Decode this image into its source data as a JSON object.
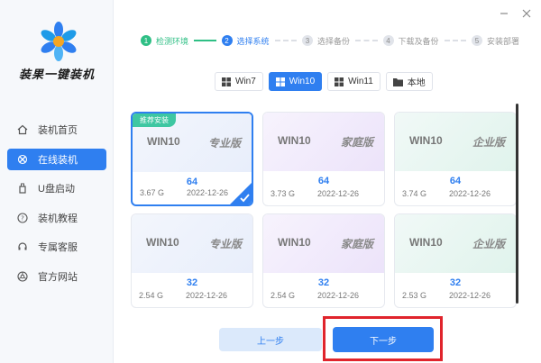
{
  "app": {
    "title": "装果一键装机"
  },
  "sidebar": {
    "items": [
      {
        "label": "装机首页",
        "icon": "home-icon"
      },
      {
        "label": "在线装机",
        "icon": "online-install-icon",
        "active": true
      },
      {
        "label": "U盘启动",
        "icon": "usb-icon"
      },
      {
        "label": "装机教程",
        "icon": "help-icon"
      },
      {
        "label": "专属客服",
        "icon": "headset-icon"
      },
      {
        "label": "官方网站",
        "icon": "browser-icon"
      }
    ]
  },
  "steps": [
    {
      "num": "1",
      "label": "检测环境",
      "state": "done"
    },
    {
      "num": "2",
      "label": "选择系统",
      "state": "current"
    },
    {
      "num": "3",
      "label": "选择备份",
      "state": "todo"
    },
    {
      "num": "4",
      "label": "下载及备份",
      "state": "todo"
    },
    {
      "num": "5",
      "label": "安装部署",
      "state": "todo"
    }
  ],
  "tabs": [
    {
      "label": "Win7",
      "icon": "windows-icon"
    },
    {
      "label": "Win10",
      "icon": "windows-icon",
      "active": true
    },
    {
      "label": "Win11",
      "icon": "windows-icon"
    },
    {
      "label": "本地",
      "icon": "folder-icon"
    }
  ],
  "cards": [
    {
      "name": "WIN10",
      "edition": "专业版",
      "bits": "64",
      "size": "3.67 G",
      "date": "2022-12-26",
      "color": "blue",
      "badge": "推荐安装",
      "selected": true
    },
    {
      "name": "WIN10",
      "edition": "家庭版",
      "bits": "64",
      "size": "3.73 G",
      "date": "2022-12-26",
      "color": "purple"
    },
    {
      "name": "WIN10",
      "edition": "企业版",
      "bits": "64",
      "size": "3.74 G",
      "date": "2022-12-26",
      "color": "green"
    },
    {
      "name": "WIN10",
      "edition": "专业版",
      "bits": "32",
      "size": "2.54 G",
      "date": "2022-12-26",
      "color": "blue"
    },
    {
      "name": "WIN10",
      "edition": "家庭版",
      "bits": "32",
      "size": "2.54 G",
      "date": "2022-12-26",
      "color": "purple"
    },
    {
      "name": "WIN10",
      "edition": "企业版",
      "bits": "32",
      "size": "2.53 G",
      "date": "2022-12-26",
      "color": "green"
    }
  ],
  "buttons": {
    "prev": "上一步",
    "next": "下一步"
  },
  "colors": {
    "accent": "#2f7ff0",
    "done": "#2fbf85",
    "badge": "#3ec7a2",
    "highlight": "#e0242c"
  }
}
